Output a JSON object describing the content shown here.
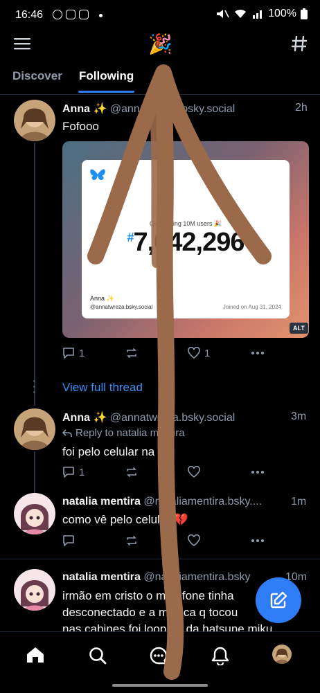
{
  "status_bar": {
    "time": "16:46",
    "battery": "100%"
  },
  "header": {
    "logo_icon": "party-popper-icon",
    "menu_icon": "hamburger-menu-icon",
    "feeds_icon": "hashtag-icon"
  },
  "tabs": [
    {
      "label": "Discover"
    },
    {
      "label": "Following"
    }
  ],
  "posts": [
    {
      "author": "Anna ✨",
      "handle": "@annatwreza.bsky.social",
      "time": "2h",
      "text": "Fofooo",
      "embed": {
        "celebration_text": "Celebrating 10M users 🎉",
        "user_number": "7,042,296",
        "name": "Anna ✨",
        "handle": "@annatwreza.bsky.social",
        "joined": "Joined on Aug 31, 2024",
        "alt_label": "ALT"
      },
      "replies": "1",
      "likes": "1"
    },
    {
      "view_full_thread": "View full thread"
    },
    {
      "author": "Anna ✨",
      "handle": "@annatwreza.bsky.social",
      "time": "3m",
      "reply_to": "Reply to natalia mentira",
      "text": "foi pelo celular na",
      "replies": "1"
    },
    {
      "author": "natalia mentira",
      "handle": "@nataliamentira.bsky....",
      "time": "1m",
      "text": "como vê pelo celular 💔"
    },
    {
      "author": "natalia mentira",
      "handle": "@nataliamentira.bsky",
      "time": "10m",
      "text_lines": [
        "irmão em cristo o meu fone tinha",
        "desconectado e a musica q tocou",
        "nas cabines foi loop 29 da hatsune miku"
      ]
    }
  ],
  "bottom_nav": [
    {
      "icon": "home-icon"
    },
    {
      "icon": "search-icon"
    },
    {
      "icon": "chat-icon"
    },
    {
      "icon": "bell-icon"
    },
    {
      "icon": "profile-avatar"
    }
  ],
  "colors": {
    "accent": "#2e7cf6",
    "background": "#000000",
    "muted": "#8d9bac",
    "annotation_stroke": "#9b6a4b"
  }
}
